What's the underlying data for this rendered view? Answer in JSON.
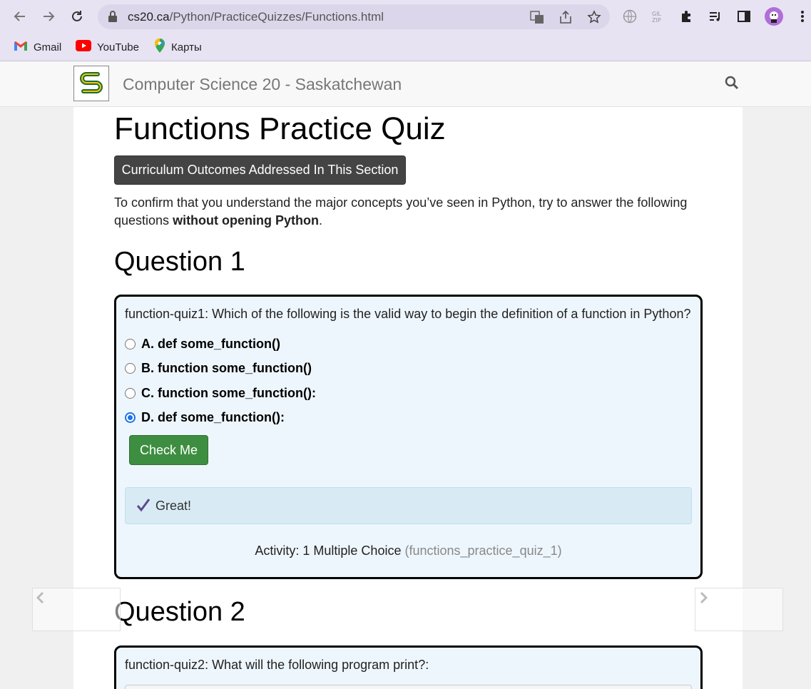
{
  "browser": {
    "url_host": "cs20.ca",
    "url_path": "/Python/PracticeQuizzes/Functions.html",
    "bookmarks": [
      {
        "label": "Gmail",
        "icon": "gmail-icon"
      },
      {
        "label": "YouTube",
        "icon": "youtube-icon"
      },
      {
        "label": "Карты",
        "icon": "maps-icon"
      }
    ]
  },
  "site": {
    "title": "Computer Science 20 - Saskatchewan"
  },
  "page": {
    "heading": "Functions Practice Quiz",
    "outcomes_button": "Curriculum Outcomes Addressed In This Section",
    "intro_text": "To confirm that you understand the major concepts you’ve seen in Python, try to answer the following questions ",
    "intro_bold": "without opening Python",
    "intro_end": "."
  },
  "questions": [
    {
      "heading": "Question 1",
      "prompt": "function-quiz1: Which of the following is the valid way to begin the definition of a function in Python?",
      "options": [
        {
          "label": "A. def some_function()",
          "selected": false
        },
        {
          "label": "B. function some_function()",
          "selected": false
        },
        {
          "label": "C. function some_function():",
          "selected": false
        },
        {
          "label": "D. def some_function():",
          "selected": true
        }
      ],
      "check_button": "Check Me",
      "feedback": "Great!",
      "activity_label": "Activity: 1 Multiple Choice",
      "activity_id": "(functions_practice_quiz_1)"
    },
    {
      "heading": "Question 2",
      "prompt": "function-quiz2: What will the following program print?:"
    }
  ],
  "colors": {
    "accent_green": "#3e8e41",
    "feedback_bg": "#d8ebf5",
    "quiz_bg": "#eef6fd",
    "chrome_bg": "#e8e3f3"
  }
}
